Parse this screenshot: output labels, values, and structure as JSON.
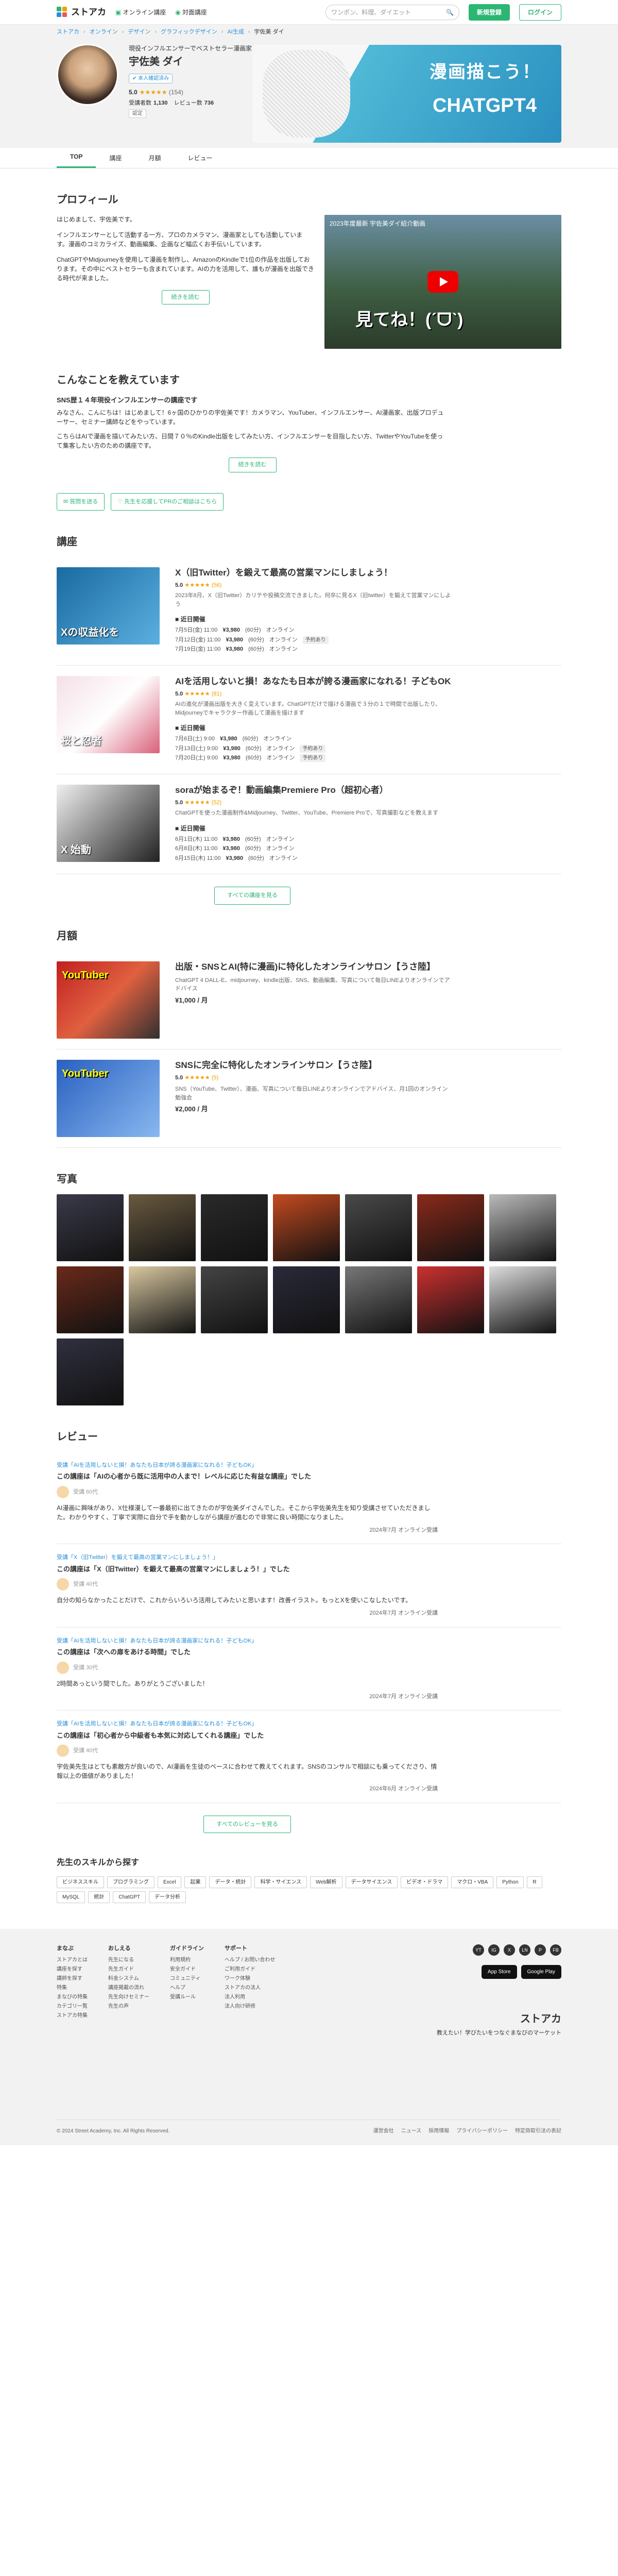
{
  "header": {
    "logo": "ストアカ",
    "nav": [
      "オンライン講座",
      "対面講座"
    ],
    "search_placeholder": "ワンポン、料理、ダイエット",
    "signup": "新規登録",
    "login": "ログイン"
  },
  "breadcrumb": [
    "ストアカ",
    "オンライン",
    "デザイン",
    "グラフィックデザイン",
    "AI生成",
    "宇佐美 ダイ"
  ],
  "teacher": {
    "subtitle": "現役インフルエンサーでベストセラー漫画家です",
    "name": "宇佐美 ダイ",
    "tag": "本人確認済み",
    "rating": "5.0",
    "rating_count": "(154)",
    "students_label": "受講者数",
    "students": "1,130",
    "reviews_label": "レビュー数",
    "reviews": "736",
    "badge": "認定"
  },
  "banner": {
    "line1": "漫画描こう！",
    "line2": "CHATGPT4"
  },
  "tabs": [
    "TOP",
    "講座",
    "月額",
    "レビュー"
  ],
  "profile": {
    "title": "プロフィール",
    "paragraphs": [
      "はじめまして、宇佐美です。",
      "インフルエンサーとして活動する一方、プロのカメラマン、漫画家としても活動しています。漫画のコミカライズ、動画編集、企画など幅広くお手伝いしています。",
      "ChatGPTやMidjourneyを使用して漫画を制作し、AmazonのKindleで1位の作品を出版しております。その中にベストセラーも含まれています。AIの力を活用して、誰もが漫画を出版できる時代が来ました。"
    ],
    "more": "続きを読む",
    "video_title": "2023年度最新 宇佐美ダイ紹介動画",
    "video_caption": "見てね！(ˊᗜˋ)"
  },
  "teach": {
    "title": "こんなことを教えています",
    "subtitle": "SNS歴１４年現役インフルエンサーの講座です",
    "paragraphs": [
      "みなさん、こんにちは！はじめまして！6ヶ国のひかりの宇佐美です！カメラマン、YouTuber、インフルエンサー、AI漫画家、出版プロデューサー、セミナー講師などをやっています。",
      "こちらはAIで漫画を描いてみたい方、日間７０％のKindle出版をしてみたい方、インフルエンサーを目指したい方、TwitterやYouTubeを使って集客したい方のための講座です。"
    ],
    "more": "続きを読む"
  },
  "actions": [
    "質問を送る",
    "先生を応援してPRのご相談はこちら"
  ],
  "courses_title": "講座",
  "courses": [
    {
      "title": "X（旧Twitter）を鍛えて最高の営業マンにしましょう！",
      "rating": "5.0",
      "count": "(56)",
      "desc": "2023年8月、X（旧Twitter）カリテや投稿交流できました。何卒に見るX（旧twitter）を鍛えて営業マンにしよう",
      "thumb_text": "Xの収益化を",
      "schedule_label": "近日開催",
      "rows": [
        {
          "date": "7月5日(金) 11:00",
          "price": "¥3,980",
          "note": "(60分)",
          "mode": "オンライン",
          "tag": ""
        },
        {
          "date": "7月12日(金) 11:00",
          "price": "¥3,980",
          "note": "(60分)",
          "mode": "オンライン",
          "tag": "予約あり"
        },
        {
          "date": "7月19日(金) 11:00",
          "price": "¥3,980",
          "note": "(60分)",
          "mode": "オンライン",
          "tag": ""
        }
      ]
    },
    {
      "title": "AIを活用しないと損！あなたも日本が誇る漫画家になれる！子どもOK",
      "rating": "5.0",
      "count": "(81)",
      "desc": "AIの進化が漫画出版を大きく変えています。ChatGPTだけで描ける漫画で３分の１で時間で出版したり、Midjourneyでキャラクター作画して漫画を描けます",
      "thumb_text": "桜と忍者",
      "schedule_label": "近日開催",
      "rows": [
        {
          "date": "7月6日(土) 9:00",
          "price": "¥3,980",
          "note": "(60分)",
          "mode": "オンライン",
          "tag": ""
        },
        {
          "date": "7月13日(土) 9:00",
          "price": "¥3,980",
          "note": "(60分)",
          "mode": "オンライン",
          "tag": "予約あり"
        },
        {
          "date": "7月20日(土) 9:00",
          "price": "¥3,980",
          "note": "(60分)",
          "mode": "オンライン",
          "tag": "予約あり"
        }
      ]
    },
    {
      "title": "soraが始まるぞ！動画編集Premiere Pro（超初心者）",
      "rating": "5.0",
      "count": "(52)",
      "desc": "ChatGPTを使った漫画制作&Midjourney、Twitter、YouTube、Premiere Proで、写真撮影などを教えます",
      "thumb_text": "X 始動",
      "schedule_label": "近日開催",
      "rows": [
        {
          "date": "6月1日(木) 11:00",
          "price": "¥3,980",
          "note": "(60分)",
          "mode": "オンライン",
          "tag": ""
        },
        {
          "date": "6月8日(木) 11:00",
          "price": "¥3,980",
          "note": "(60分)",
          "mode": "オンライン",
          "tag": ""
        },
        {
          "date": "6月15日(木) 11:00",
          "price": "¥3,980",
          "note": "(60分)",
          "mode": "オンライン",
          "tag": ""
        }
      ]
    }
  ],
  "courses_more": "すべての講座を見る",
  "monthly_title": "月額",
  "monthly": [
    {
      "title": "出版・SNSとAI(特に漫画)に特化したオンラインサロン【うさ陸】",
      "desc": "ChatGPT 4 DALL-E、midjourney、kindle出版、SNS、動画編集、写真について毎日LINEよりオンラインでアドバイス",
      "price": "¥1,000 / 月",
      "thumb_text": "YouTuber"
    },
    {
      "title": "SNSに完全に特化したオンラインサロン【うさ陸】",
      "rating": "5.0",
      "count": "(5)",
      "desc": "SNS（YouTube、Twitter）、漫画、写真について毎日LINEよりオンラインでアドバイス、月1回のオンライン勉強会",
      "price": "¥2,000 / 月",
      "thumb_text": "YouTuber"
    }
  ],
  "photos_title": "写真",
  "photos_colors": [
    "#3a3a4a",
    "#6a5a40",
    "#2a2a2a",
    "#c44a20",
    "#4a4a4a",
    "#8a2a1a",
    "#bbb",
    "#6a2a1a",
    "#d9c8a0",
    "#444",
    "#2a2a3a",
    "#777",
    "#cc3030",
    "#ddd",
    "#303040"
  ],
  "reviews_title": "レビュー",
  "reviews": [
    {
      "course": "受講「AIを活用しないと損！あなたも日本が誇る漫画家になれる！子どもOK」",
      "title": "この講座は「AIの心者から既に活用中の人まで！レベルに応じた有益な講座」でした",
      "user": "受講 60代",
      "text": "AI漫画に興味があり、X仕様漫して一番最初に出てきたのが宇佐美ダイさんでした。そこから宇佐美先生を知り受講させていただきました。わかりやすく、丁寧で実際に自分で手を動かしながら講座が進むので非常に良い時間になりました。",
      "date": "2024年7月 オンライン受講"
    },
    {
      "course": "受講「X（旧Twitter）を鍛えて最高の営業マンにしましょう！」",
      "title": "この講座は「X（旧Twitter）を鍛えて最高の営業マンにしましょう！」でした",
      "user": "受講 40代",
      "text": "自分の知らなかったことだけで、これからいろいろ活用してみたいと思います！改善イラスト。もっとXを使いこなしたいです。",
      "date": "2024年7月 オンライン受講"
    },
    {
      "course": "受講「AIを活用しないと損！あなたも日本が誇る漫画家になれる！子どもOK」",
      "title": "この講座は「次への扉をあける時間」でした",
      "user": "受講 30代",
      "text": "2時間あっという間でした。ありがとうございました！",
      "date": "2024年7月 オンライン受講"
    },
    {
      "course": "受講「AIを活用しないと損！あなたも日本が誇る漫画家になれる！子どもOK」",
      "title": "この講座は「初心者から中級者も本気に対応してくれる講座」でした",
      "user": "受講 40代",
      "text": "宇佐美先生はとても素敵方が良いので、AI漫画を生徒のペースに合わせて教えてくれます。SNSのコンサルで相談にも乗ってくださり、情報以上の価値がありました！",
      "date": "2024年6月 オンライン受講"
    }
  ],
  "reviews_more": "すべてのレビューを見る",
  "skills_title": "先生のスキルから探す",
  "skills": [
    "ビジネススキル",
    "プログラミング",
    "Excel",
    "起業",
    "データ・統計",
    "科学・サイエンス",
    "Web解析",
    "データサイエンス",
    "ビデオ・ドラマ",
    "マクロ・VBA",
    "Python",
    "R",
    "MySQL",
    "統計",
    "ChatGPT",
    "データ分析"
  ],
  "footer": {
    "cols": [
      {
        "title": "まなぶ",
        "items": [
          "ストアカとは",
          "講座を探す",
          "講師を探す",
          "特集",
          "まなびの特集",
          "カテゴリ一覧",
          "ストアカ特集"
        ]
      },
      {
        "title": "おしえる",
        "items": [
          "先生になる",
          "先生ガイド",
          "料金システム",
          "講座掲載の流れ",
          "先生向けセミナー",
          "先生の声"
        ]
      },
      {
        "title": "ガイドライン",
        "items": [
          "利用規約",
          "安全ガイド",
          "コミュニティ",
          "ヘルプ",
          "受講ルール"
        ]
      },
      {
        "title": "サポート",
        "items": [
          "ヘルプ / お問い合わせ",
          "ご利用ガイド",
          "ワーク体験",
          "ストアカの法人",
          "法人利用",
          "法人向け研修"
        ]
      }
    ],
    "social": [
      "YT",
      "IG",
      "X",
      "LN",
      "P",
      "FB"
    ],
    "stores": [
      "App Store",
      "Google Play"
    ],
    "logo": "ストアカ",
    "tagline": "教えたい！学びたいをつなぐまなびのマーケット",
    "copyright": "© 2024 Street Academy, Inc. All Rights Reserved.",
    "links": [
      "運営会社",
      "ニュース",
      "採用情報",
      "プライバシーポリシー",
      "特定商取引法の表記"
    ]
  }
}
